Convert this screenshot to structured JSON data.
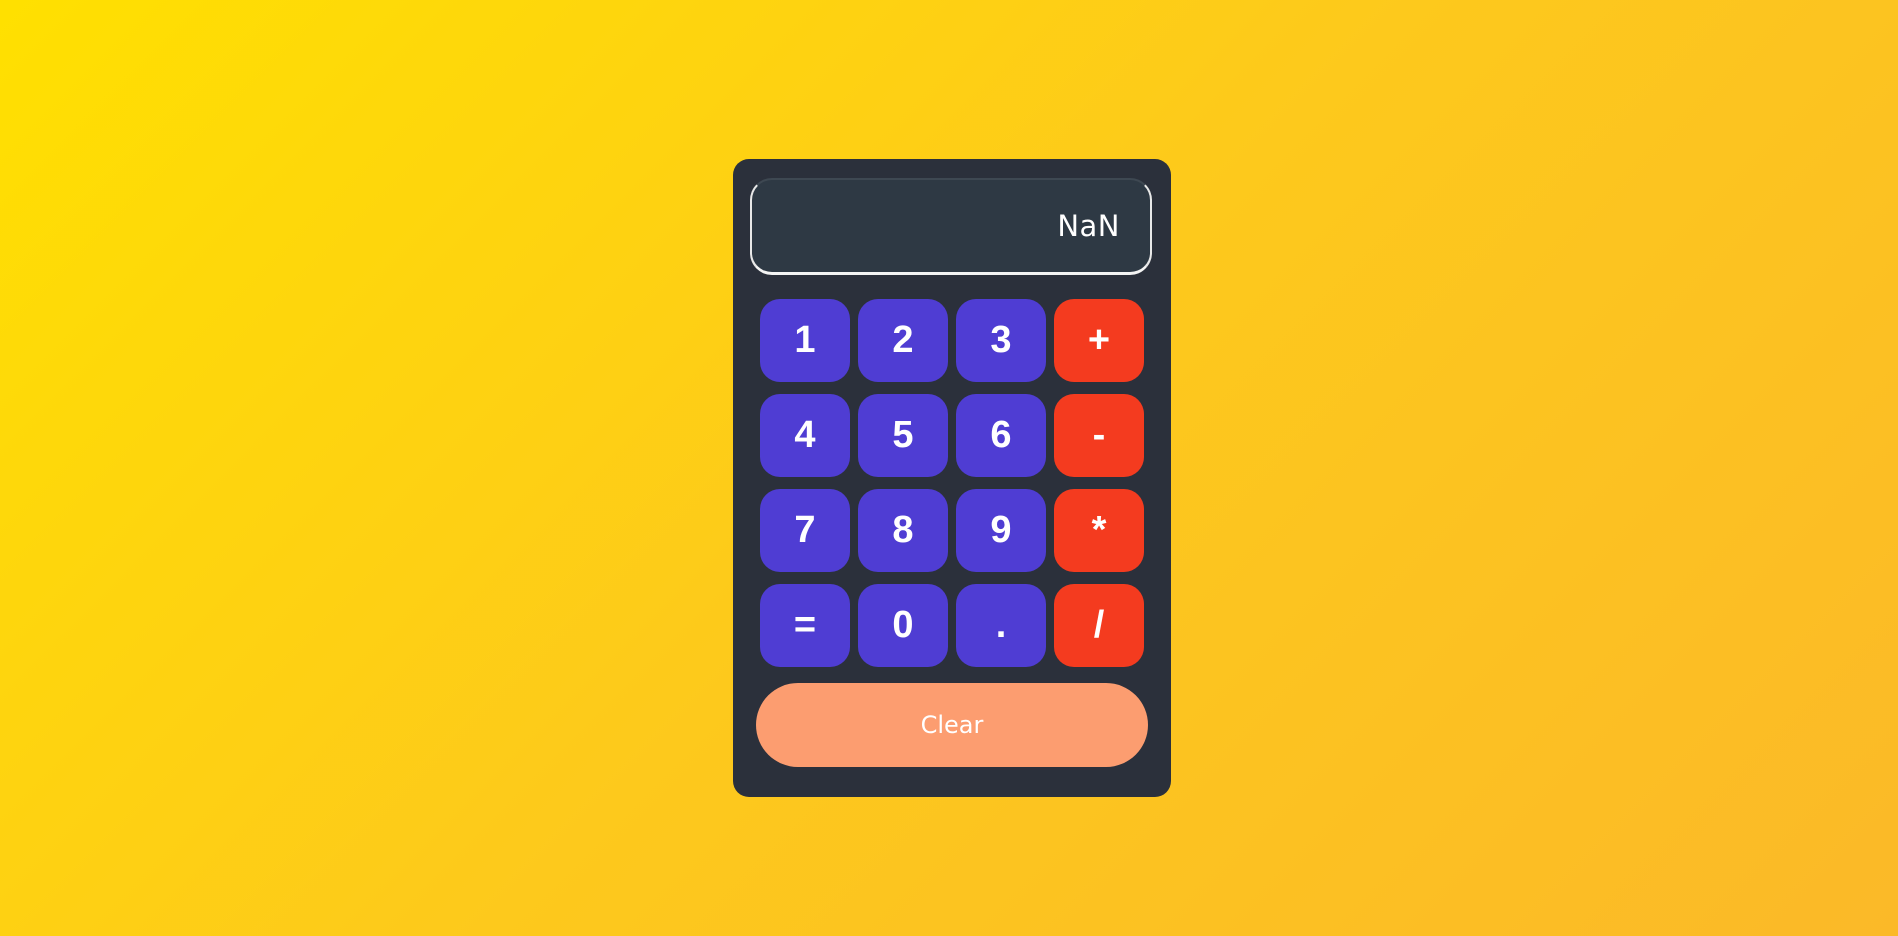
{
  "display": {
    "value": "NaN"
  },
  "keys": [
    {
      "label": "1",
      "kind": "num",
      "name": "key-1"
    },
    {
      "label": "2",
      "kind": "num",
      "name": "key-2"
    },
    {
      "label": "3",
      "kind": "num",
      "name": "key-3"
    },
    {
      "label": "+",
      "kind": "op",
      "name": "key-add"
    },
    {
      "label": "4",
      "kind": "num",
      "name": "key-4"
    },
    {
      "label": "5",
      "kind": "num",
      "name": "key-5"
    },
    {
      "label": "6",
      "kind": "num",
      "name": "key-6"
    },
    {
      "label": "-",
      "kind": "op",
      "name": "key-subtract"
    },
    {
      "label": "7",
      "kind": "num",
      "name": "key-7"
    },
    {
      "label": "8",
      "kind": "num",
      "name": "key-8"
    },
    {
      "label": "9",
      "kind": "num",
      "name": "key-9"
    },
    {
      "label": "*",
      "kind": "op",
      "name": "key-multiply"
    },
    {
      "label": "=",
      "kind": "num",
      "name": "key-equals"
    },
    {
      "label": "0",
      "kind": "num",
      "name": "key-0"
    },
    {
      "label": ".",
      "kind": "num",
      "name": "key-decimal"
    },
    {
      "label": "/",
      "kind": "op",
      "name": "key-divide"
    }
  ],
  "clear": {
    "label": "Clear"
  },
  "colors": {
    "background_start": "#ffe000",
    "background_end": "#fbb928",
    "body": "#2b303b",
    "display": "#2e3944",
    "number_key": "#4f3dd3",
    "operator_key": "#f43b1f",
    "clear_button": "#fc9d70",
    "text": "#ffffff"
  }
}
